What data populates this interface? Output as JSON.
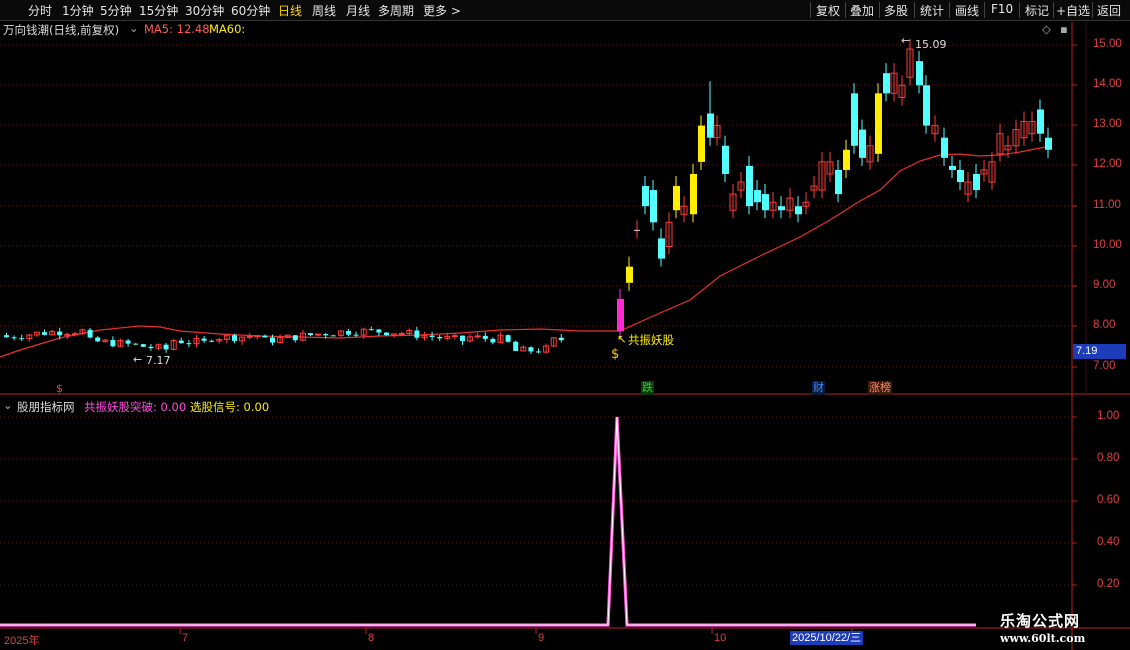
{
  "toolbar": {
    "left_items": [
      "分时",
      "1分钟",
      "5分钟",
      "15分钟",
      "30分钟",
      "60分钟",
      "日线",
      "周线",
      "月线",
      "多周期",
      "更多 >"
    ],
    "active": "日线",
    "right_items": [
      "复权",
      "叠加",
      "多股",
      "统计",
      "画线",
      "F10",
      "+自选",
      "返回"
    ],
    "right_last_item": "标记"
  },
  "main_chart": {
    "title": "万向钱潮(日线,前复权)",
    "ma5_label": "MA5: 12.48",
    "ma60_label": "MA60:",
    "y_axis": [
      "15.00",
      "14.00",
      "13.00",
      "12.00",
      "11.00",
      "10.00",
      "9.00",
      "8.00",
      "7.00"
    ],
    "current_price": "7.19",
    "high_annotation": "15.09",
    "low_annotation": "7.17",
    "signal_annotation": "共振妖股",
    "events": [
      {
        "label": "跌",
        "color": "#2ecc40"
      },
      {
        "label": "财",
        "color": "#3f8cff"
      },
      {
        "label": "涨榜",
        "color": "#ff8c69"
      }
    ],
    "event_marker_left": "$",
    "colors": {
      "up": "#ff3b3b",
      "down": "#54ffff",
      "limit_up": "#ffee00",
      "signal_bar": "#ff2ad4",
      "ma": "#e83030"
    }
  },
  "sub_chart": {
    "title": "股朋指标网",
    "series1_label": "共振妖股突破: 0.00",
    "series2_label": "选股信号: 0.00",
    "y_axis": [
      "1.00",
      "0.80",
      "0.60",
      "0.40",
      "0.20"
    ]
  },
  "time_axis": {
    "labels": [
      "2025年",
      "7",
      "8",
      "9",
      "10"
    ],
    "selected_date": "2025/10/22/三"
  },
  "watermark": {
    "title": "乐淘公式网",
    "url": "www.60lt.com"
  }
}
